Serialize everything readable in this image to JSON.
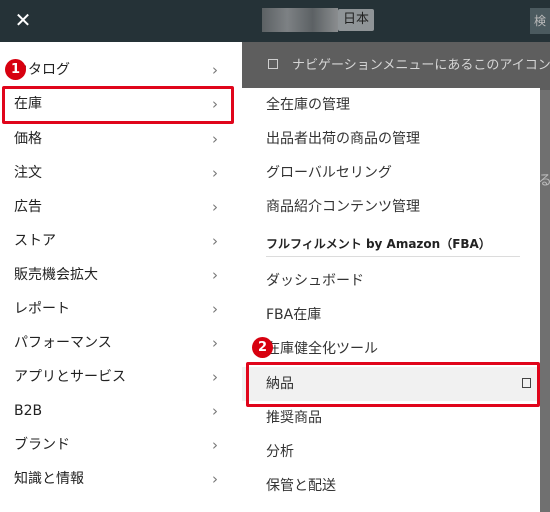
{
  "background": {
    "language_chip": "日本",
    "strip_text": "ナビゲーションメニューにあるこのアイコン",
    "right_button": "検",
    "right_char": "る"
  },
  "sidebar": {
    "close_icon": "✕",
    "items": [
      {
        "label": "カタログ"
      },
      {
        "label": "在庫"
      },
      {
        "label": "価格"
      },
      {
        "label": "注文"
      },
      {
        "label": "広告"
      },
      {
        "label": "ストア"
      },
      {
        "label": "販売機会拡大"
      },
      {
        "label": "レポート"
      },
      {
        "label": "パフォーマンス"
      },
      {
        "label": "アプリとサービス"
      },
      {
        "label": "B2B"
      },
      {
        "label": "ブランド"
      },
      {
        "label": "知識と情報"
      }
    ],
    "chevron": "›"
  },
  "submenu": {
    "items_top": [
      {
        "label": "全在庫の管理"
      },
      {
        "label": "出品者出荷の商品の管理"
      },
      {
        "label": "グローバルセリング"
      },
      {
        "label": "商品紹介コンテンツ管理"
      }
    ],
    "section_title": "フルフィルメント by Amazon（FBA）",
    "items_fba": [
      {
        "label": "ダッシュボード"
      },
      {
        "label": "FBA在庫"
      },
      {
        "label": "在庫健全化ツール"
      },
      {
        "label": "納品"
      },
      {
        "label": "推奨商品"
      },
      {
        "label": "分析"
      },
      {
        "label": "保管と配送"
      }
    ]
  },
  "annotations": {
    "badge1": "1",
    "badge2": "2",
    "color": "#e0051b"
  }
}
